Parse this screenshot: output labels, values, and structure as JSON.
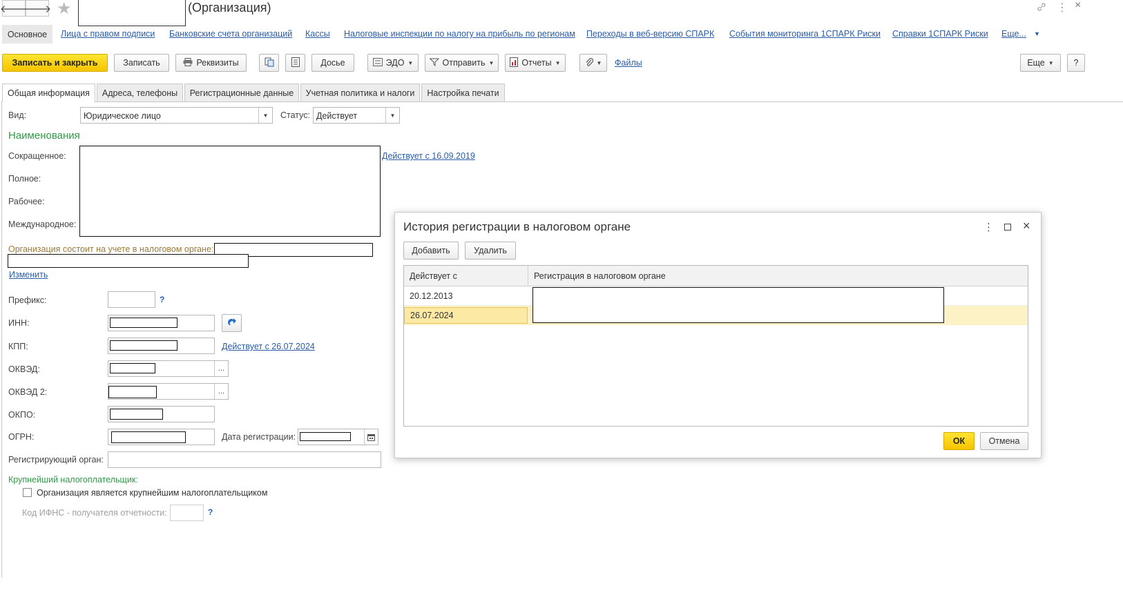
{
  "window": {
    "title": "(Организация)",
    "nav_back": "🡐",
    "nav_forward": "🡒",
    "star": "★",
    "link_icon": "🔗",
    "more_icon": "⋮",
    "close_icon": "×"
  },
  "nav_links": {
    "osnovnoe": "Основное",
    "items": [
      "Лица с правом подписи",
      "Банковские счета организаций",
      "Кассы",
      "Налоговые инспекции по налогу на прибыль по регионам",
      "Переходы в веб-версию СПАРК",
      "События мониторинга 1СПАРК Риски",
      "Справки 1СПАРК Риски",
      "Еще..."
    ]
  },
  "toolbar": {
    "save_close": "Записать и закрыть",
    "save": "Записать",
    "requisites": "Реквизиты",
    "dossier": "Досье",
    "edo": "ЭДО",
    "send": "Отправить",
    "reports": "Отчеты",
    "files": "Файлы",
    "more": "Еще",
    "help": "?"
  },
  "tabs": [
    "Общая информация",
    "Адреса, телефоны",
    "Регистрационные данные",
    "Учетная политика и налоги",
    "Настройка печати"
  ],
  "form": {
    "vid_label": "Вид:",
    "vid_value": "Юридическое лицо",
    "status_label": "Статус:",
    "status_value": "Действует",
    "names_header": "Наименования",
    "short_label": "Сокращенное:",
    "full_label": "Полное:",
    "work_label": "Рабочее:",
    "intl_label": "Международное:",
    "names_valid": "Действует с 16.09.2019",
    "tax_reg_label": "Организация состоит на учете в налоговом органе:",
    "change_link": "Изменить",
    "prefix_label": "Префикс:",
    "q": "?",
    "inn_label": "ИНН:",
    "kpp_label": "КПП:",
    "kpp_valid": "Действует с 26.07.2024",
    "okved_label": "ОКВЭД:",
    "okved2_label": "ОКВЭД 2:",
    "okpo_label": "ОКПО:",
    "ogrn_label": "ОГРН:",
    "reg_date_label": "Дата регистрации:",
    "reg_organ_label": "Регистрирующий орган:",
    "largest_header": "Крупнейший налогоплательщик:",
    "largest_checkbox": "Организация является крупнейшим налогоплательщиком",
    "ifns_label": "Код ИФНС - получателя отчетности:",
    "ellipsis": "..."
  },
  "dialog": {
    "title": "История регистрации в налоговом органе",
    "add": "Добавить",
    "delete": "Удалить",
    "col1": "Действует с",
    "col2": "Регистрация в налоговом органе",
    "rows": [
      {
        "date": "20.12.2013"
      },
      {
        "date": "26.07.2024"
      }
    ],
    "ok": "ОК",
    "cancel": "Отмена"
  },
  "colors": {
    "accent_yellow": "#f5c400",
    "link_blue": "#2a5ca8",
    "section_green": "#2f9a47",
    "selected_row": "#fdf2c6"
  }
}
